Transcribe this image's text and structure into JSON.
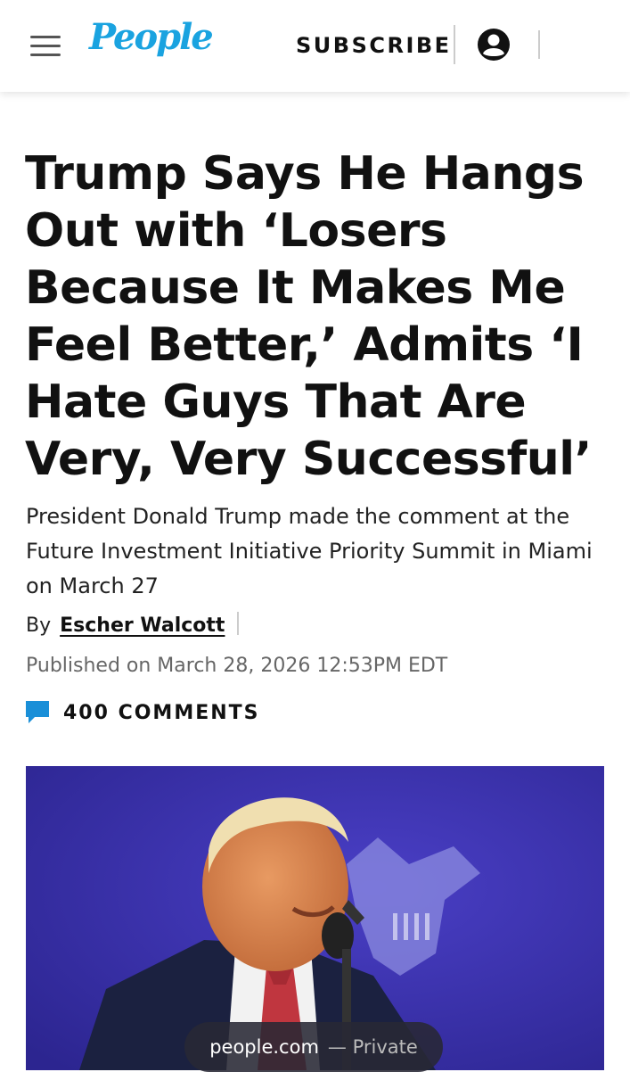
{
  "header": {
    "logo": "People",
    "subscribe_label": "SUBSCRIBE",
    "brand_color": "#1aa3e0"
  },
  "article": {
    "headline": "Trump Says He Hangs Out with ‘Losers Because It Makes Me Feel Better,’ Admits ‘I Hate Guys That Are Very, Very Successful’",
    "dek": "President Donald Trump made the comment at the Future Investment Initiative Priority Summit in Miami on March 27",
    "by_prefix": "By",
    "author": "Escher Walcott",
    "published": "Published on March 28, 2026 12:53PM EDT",
    "comments_label": "400 COMMENTS",
    "comment_icon_color": "#1a8fd8"
  },
  "browser_pill": {
    "domain": "people.com",
    "mode": "— Private"
  },
  "icons": {
    "menu": "hamburger-menu-icon",
    "account": "account-circle-icon",
    "comments": "comment-bubble-icon"
  }
}
